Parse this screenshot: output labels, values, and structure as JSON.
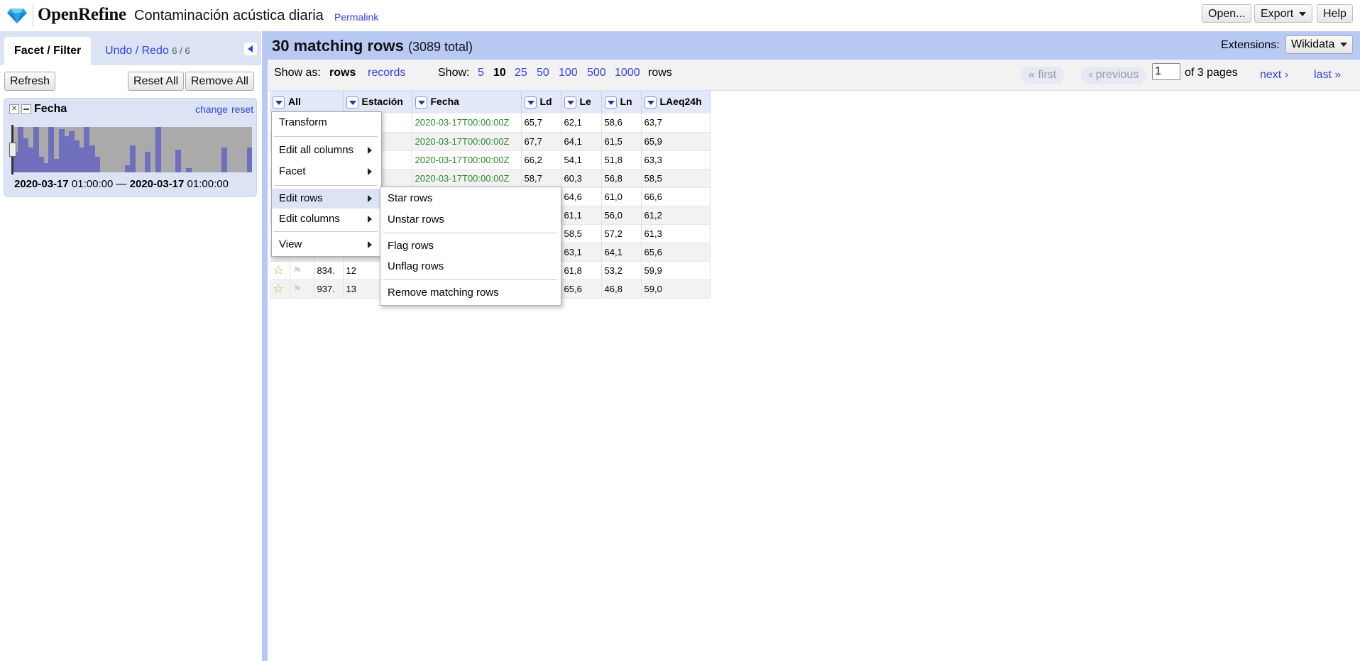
{
  "header": {
    "logo_text": "OpenRefine",
    "project_title": "Contaminación acústica diaria",
    "permalink": "Permalink",
    "open_label": "Open...",
    "export_label": "Export",
    "help_label": "Help"
  },
  "left": {
    "tab_facet": "Facet / Filter",
    "tab_undo": "Undo / Redo",
    "undo_count": "6 / 6",
    "refresh": "Refresh",
    "reset_all": "Reset All",
    "remove_all": "Remove All"
  },
  "facet": {
    "title": "Fecha",
    "change": "change",
    "reset": "reset",
    "range_from_date": "2020-03-17",
    "range_from_time": "01:00:00",
    "dash": "—",
    "range_to_date": "2020-03-17",
    "range_to_time": "01:00:00",
    "histogram_levels": [
      0.45,
      1,
      0.75,
      0.55,
      1,
      0.35,
      0.2,
      1,
      0.3,
      0.95,
      0.8,
      0.9,
      0.7,
      0.55,
      1,
      0.6,
      0.35,
      0,
      0,
      0,
      0,
      0,
      0.15,
      0.6,
      0,
      0,
      0.45,
      0,
      1,
      0,
      0,
      0,
      0.5,
      0,
      0.1,
      0,
      0,
      0,
      0,
      0,
      0,
      0.55,
      0,
      0,
      0,
      0,
      0.55
    ]
  },
  "rows_header": {
    "count": "30 matching rows",
    "total": "(3089 total)",
    "extensions_label": "Extensions:",
    "extensions_button": "Wikidata"
  },
  "view_bar": {
    "show_as": "Show as:",
    "rows_mode": "rows",
    "records_mode": "records",
    "show": "Show:",
    "sizes": [
      "5",
      "10",
      "25",
      "50",
      "100",
      "500",
      "1000"
    ],
    "rows_suffix": "rows",
    "first": "« first",
    "previous": "‹ previous",
    "page_value": "1",
    "of_pages": "of 3 pages",
    "next": "next ›",
    "last": "last »"
  },
  "table": {
    "columns": [
      "All",
      "Estación",
      "Fecha",
      "Ld",
      "Le",
      "Ln",
      "LAeq24h"
    ],
    "rows": [
      {
        "row": "",
        "est": "",
        "fecha": "2020-03-17T00:00:00Z",
        "ld": "65,7",
        "le": "62,1",
        "ln": "58,6",
        "laeq": "63,7"
      },
      {
        "row": "",
        "est": "",
        "fecha": "2020-03-17T00:00:00Z",
        "ld": "67,7",
        "le": "64,1",
        "ln": "61,5",
        "laeq": "65,9"
      },
      {
        "row": "",
        "est": "",
        "fecha": "2020-03-17T00:00:00Z",
        "ld": "66,2",
        "le": "54,1",
        "ln": "51,8",
        "laeq": "63,3"
      },
      {
        "row": "",
        "est": "",
        "fecha": "2020-03-17T00:00:00Z",
        "ld": "58,7",
        "le": "60,3",
        "ln": "56,8",
        "laeq": "58,5"
      },
      {
        "row": "",
        "est": "",
        "fecha": "",
        "ld": "",
        "le": "64,6",
        "ln": "61,0",
        "laeq": "66,6"
      },
      {
        "row": "",
        "est": "",
        "fecha": "",
        "ld": "",
        "le": "61,1",
        "ln": "56,0",
        "laeq": "61,2"
      },
      {
        "row": "",
        "est": "",
        "fecha": "",
        "ld": "",
        "le": "58,5",
        "ln": "57,2",
        "laeq": "61,3"
      },
      {
        "row": "",
        "est": "",
        "fecha": "",
        "ld": "",
        "le": "63,1",
        "ln": "64,1",
        "laeq": "65,6"
      },
      {
        "row": "834.",
        "est": "12",
        "fecha": "",
        "ld": "",
        "le": "61,8",
        "ln": "53,2",
        "laeq": "59,9"
      },
      {
        "row": "937.",
        "est": "13",
        "fecha": "",
        "ld": "",
        "le": "65,6",
        "ln": "46,8",
        "laeq": "59,0"
      }
    ]
  },
  "menu": {
    "transform": "Transform",
    "edit_all_columns": "Edit all columns",
    "facet": "Facet",
    "edit_rows": "Edit rows",
    "edit_columns": "Edit columns",
    "view": "View"
  },
  "submenu": {
    "star_rows": "Star rows",
    "unstar_rows": "Unstar rows",
    "flag_rows": "Flag rows",
    "unflag_rows": "Unflag rows",
    "remove_matching_rows": "Remove matching rows"
  },
  "colors": {
    "accent": "#3344dd",
    "panel_blue": "#b8c9f4",
    "date_green": "#2a8a2a"
  }
}
